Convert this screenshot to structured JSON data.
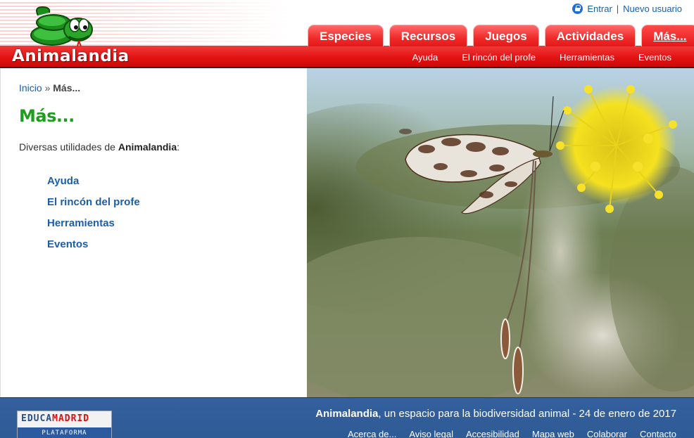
{
  "site": {
    "logo_text": "Animalandia"
  },
  "userbar": {
    "login": "Entrar",
    "separator": "|",
    "register": "Nuevo usuario"
  },
  "tabs": [
    {
      "label": "Especies"
    },
    {
      "label": "Recursos"
    },
    {
      "label": "Juegos"
    },
    {
      "label": "Actividades"
    },
    {
      "label": "Más..."
    }
  ],
  "subnav": [
    {
      "label": "Ayuda"
    },
    {
      "label": "El rincón del profe"
    },
    {
      "label": "Herramientas"
    },
    {
      "label": "Eventos"
    }
  ],
  "breadcrumb": {
    "home": "Inicio",
    "separator": "»",
    "current": "Más..."
  },
  "page": {
    "title": "Más...",
    "intro_prefix": "Diversas utilidades de ",
    "intro_brand": "Animalandia",
    "intro_suffix": ":"
  },
  "menu": [
    {
      "label": "Ayuda"
    },
    {
      "label": "El rincón del profe"
    },
    {
      "label": "Herramientas"
    },
    {
      "label": "Eventos"
    }
  ],
  "footer": {
    "edu_line1_a": "EDUCA",
    "edu_line1_b": "MADRID",
    "edu_line2": "PLATAFORMA TECNOLÓGICA",
    "tag_brand": "Animalandia",
    "tag_rest": ", un espacio para la biodiversidad animal - 24 de enero de 2017",
    "links": [
      {
        "label": "Acerca de..."
      },
      {
        "label": "Aviso legal"
      },
      {
        "label": "Accesibilidad"
      },
      {
        "label": "Mapa web"
      },
      {
        "label": "Colaborar"
      },
      {
        "label": "Contacto"
      }
    ]
  },
  "colors": {
    "brand_red": "#e31212",
    "title_green": "#1e9e1e",
    "link_blue": "#1a5fa8",
    "footer_blue": "#2e5a95"
  }
}
